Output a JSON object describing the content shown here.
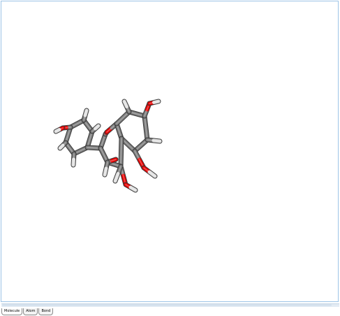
{
  "tabs": [
    {
      "label": "Molecule",
      "active": true
    },
    {
      "label": "Atom",
      "active": false
    },
    {
      "label": "Bond",
      "active": false
    }
  ],
  "colors": {
    "carbon": "#7a7a7a",
    "oxygen": "#e60000",
    "hydrogen": "#e0e0e0",
    "frame": "#9cc3e6"
  }
}
